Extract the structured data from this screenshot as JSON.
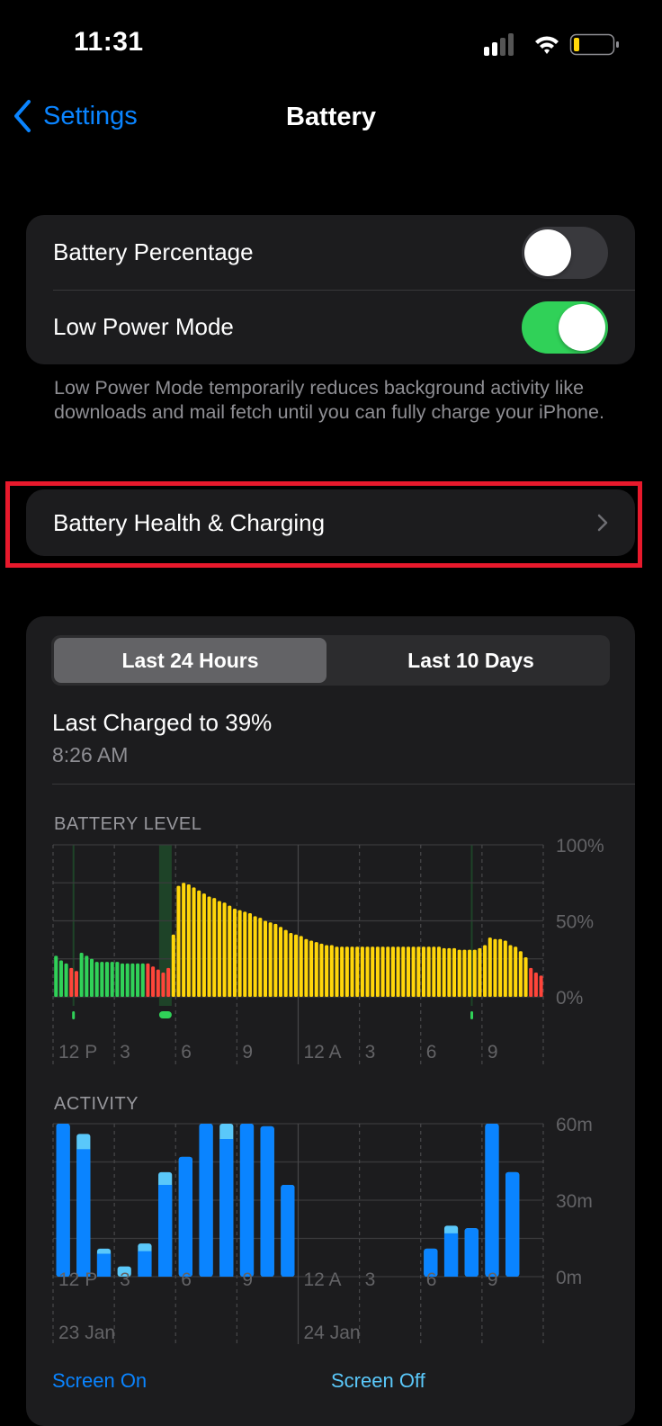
{
  "status_bar": {
    "time": "11:31",
    "icons": [
      "cellular-signal-icon",
      "wifi-icon",
      "battery-icon"
    ],
    "battery_fill_color": "#ffd60a"
  },
  "nav": {
    "back_label": "Settings",
    "back_icon": "chevron-left-icon",
    "title": "Battery"
  },
  "settings": {
    "battery_percentage": {
      "label": "Battery Percentage",
      "enabled": false
    },
    "low_power_mode": {
      "label": "Low Power Mode",
      "enabled": true
    },
    "footnote": "Low Power Mode temporarily reduces background activity like downloads and mail fetch until you can fully charge your iPhone."
  },
  "health_row": {
    "label": "Battery Health & Charging",
    "icon": "chevron-right-icon",
    "highlighted": true
  },
  "usage": {
    "segments": [
      {
        "label": "Last 24 Hours",
        "selected": true
      },
      {
        "label": "Last 10 Days",
        "selected": false
      }
    ],
    "last_charged_title": "Last Charged to 39%",
    "last_charged_time": "8:26 AM",
    "legend": {
      "screen_on": "Screen On",
      "screen_off": "Screen Off"
    }
  },
  "colors": {
    "accent": "#0a84ff",
    "toggle_on": "#30d158",
    "battery_green": "#30d158",
    "battery_red": "#ff453a",
    "battery_yellow": "#ffd60a",
    "activity_screen_on": "#0a84ff",
    "activity_screen_off": "#5ac8fa",
    "highlight_box": "#e8192c"
  },
  "chart_data": [
    {
      "type": "bar",
      "title": "BATTERY LEVEL",
      "ylabel": "",
      "ylim": [
        0,
        100
      ],
      "y_ticks": [
        "100%",
        "50%",
        "0%"
      ],
      "x_ticks": [
        "12 P",
        "3",
        "6",
        "9",
        "12 A",
        "3",
        "6",
        "9"
      ],
      "grid": true,
      "interval_minutes": 15,
      "values": [
        27,
        24,
        22,
        19,
        17,
        29,
        27,
        25,
        23,
        23,
        23,
        23,
        23,
        22,
        22,
        22,
        22,
        22,
        22,
        20,
        18,
        16,
        19,
        41,
        73,
        75,
        74,
        72,
        70,
        68,
        66,
        65,
        63,
        62,
        60,
        58,
        57,
        56,
        55,
        53,
        52,
        50,
        49,
        48,
        46,
        44,
        42,
        41,
        40,
        38,
        37,
        36,
        35,
        34,
        34,
        33,
        33,
        33,
        33,
        33,
        33,
        33,
        33,
        33,
        33,
        33,
        33,
        33,
        33,
        33,
        33,
        33,
        33,
        33,
        33,
        33,
        32,
        32,
        32,
        31,
        31,
        31,
        31,
        32,
        34,
        39,
        38,
        38,
        37,
        34,
        33,
        30,
        26,
        19,
        16,
        14
      ],
      "states": [
        "g",
        "g",
        "g",
        "r",
        "r",
        "g",
        "g",
        "g",
        "g",
        "g",
        "g",
        "g",
        "g",
        "g",
        "g",
        "g",
        "g",
        "g",
        "r",
        "r",
        "r",
        "r",
        "r",
        "y",
        "y",
        "y",
        "y",
        "y",
        "y",
        "y",
        "y",
        "y",
        "y",
        "y",
        "y",
        "y",
        "y",
        "y",
        "y",
        "y",
        "y",
        "y",
        "y",
        "y",
        "y",
        "y",
        "y",
        "y",
        "y",
        "y",
        "y",
        "y",
        "y",
        "y",
        "y",
        "y",
        "y",
        "y",
        "y",
        "y",
        "y",
        "y",
        "y",
        "y",
        "y",
        "y",
        "y",
        "y",
        "y",
        "y",
        "y",
        "y",
        "y",
        "y",
        "y",
        "y",
        "y",
        "y",
        "y",
        "y",
        "y",
        "y",
        "y",
        "y",
        "y",
        "y",
        "y",
        "y",
        "y",
        "y",
        "y",
        "y",
        "y",
        "r",
        "r",
        "r"
      ],
      "charging_markers": [
        {
          "label": "charge-1",
          "hour_index": 1.0
        },
        {
          "label": "charge-2",
          "hour_index": 5.5
        },
        {
          "label": "charge-3",
          "hour_index": 20.5
        }
      ]
    },
    {
      "type": "bar",
      "title": "ACTIVITY",
      "ylim": [
        0,
        60
      ],
      "y_ticks": [
        "60m",
        "30m",
        "0m"
      ],
      "x_ticks": [
        "12 P",
        "3",
        "6",
        "9",
        "12 A",
        "3",
        "6",
        "9"
      ],
      "date_labels": [
        "23 Jan",
        "24 Jan"
      ],
      "grid": true,
      "series": [
        {
          "name": "Screen On",
          "values": [
            60,
            50,
            9,
            0,
            10,
            36,
            47,
            60,
            54,
            60,
            59,
            36,
            0,
            0,
            0,
            0,
            0,
            0,
            11,
            17,
            19,
            60,
            41,
            0
          ]
        },
        {
          "name": "Screen Off",
          "values": [
            0,
            6,
            2,
            4,
            3,
            5,
            0,
            0,
            6,
            0,
            0,
            0,
            0,
            0,
            0,
            0,
            0,
            0,
            0,
            3,
            0,
            0,
            0,
            0
          ]
        }
      ]
    }
  ]
}
